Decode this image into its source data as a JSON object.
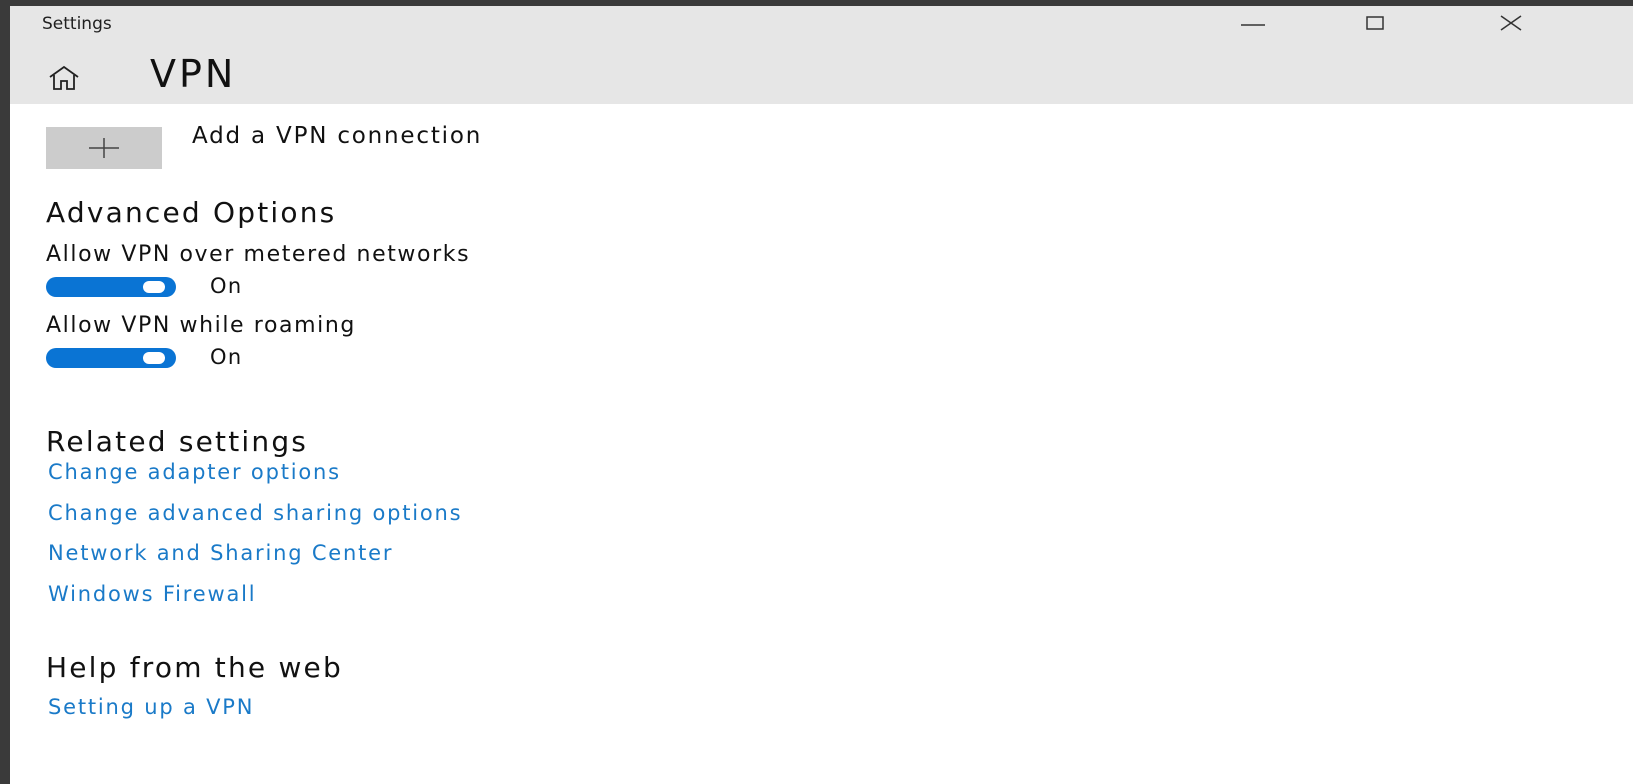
{
  "window": {
    "app_title": "Settings",
    "page_title": "VPN"
  },
  "add_vpn": {
    "label": "Add a VPN connection"
  },
  "advanced_options": {
    "heading": "Advanced Options",
    "options": [
      {
        "label": "Allow VPN over metered networks",
        "state": "On",
        "enabled": true
      },
      {
        "label": "Allow VPN while roaming",
        "state": "On",
        "enabled": true
      }
    ]
  },
  "related_settings": {
    "heading": "Related settings",
    "links": [
      "Change adapter options",
      "Change advanced sharing options",
      "Network and Sharing Center",
      "Windows Firewall"
    ]
  },
  "help": {
    "heading": "Help from the web",
    "links": [
      "Setting up a VPN"
    ]
  },
  "colors": {
    "accent": "#0a74d4",
    "link": "#1a7ac8",
    "titlebar": "#e6e6e6",
    "button": "#cccccc"
  },
  "icons": {
    "home": "home-icon",
    "minimize": "minimize-icon",
    "maximize": "maximize-icon",
    "close": "close-icon",
    "add": "plus-icon"
  }
}
